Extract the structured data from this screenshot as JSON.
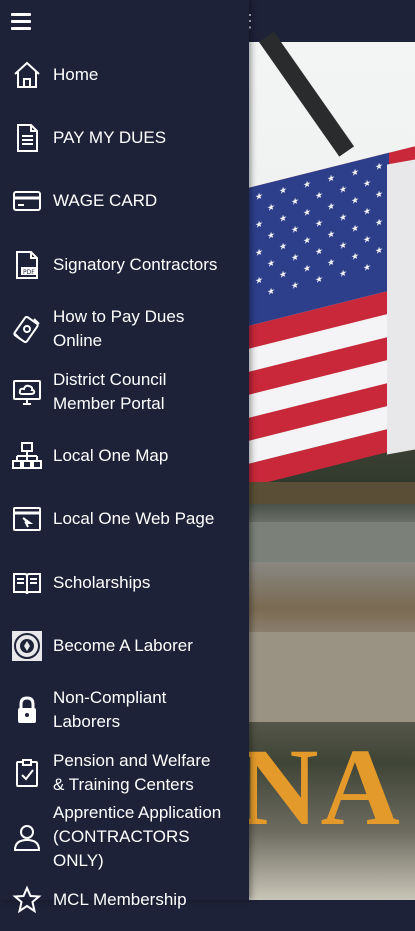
{
  "menu": {
    "items": [
      {
        "label": "Home",
        "icon": "home-icon"
      },
      {
        "label": "PAY MY DUES",
        "icon": "document-icon"
      },
      {
        "label": "WAGE CARD",
        "icon": "card-icon"
      },
      {
        "label": "Signatory Contractors",
        "icon": "pdf-icon"
      },
      {
        "label": "How to Pay Dues\nOnline",
        "icon": "money-icon"
      },
      {
        "label": "District Council\nMember Portal",
        "icon": "cloud-monitor-icon"
      },
      {
        "label": "Local One Map",
        "icon": "sitemap-icon"
      },
      {
        "label": "Local One Web Page",
        "icon": "browser-icon"
      },
      {
        "label": "Scholarships",
        "icon": "book-icon"
      },
      {
        "label": "Become A Laborer",
        "icon": "union-logo-icon"
      },
      {
        "label": "Non-Compliant\nLaborers",
        "icon": "lock-icon"
      },
      {
        "label": "Pension and Welfare\n& Training Centers",
        "icon": "clipboard-check-icon"
      },
      {
        "label": "Apprentice Application\n(CONTRACTORS ONLY)",
        "icon": "user-icon"
      },
      {
        "label": "MCL Membership",
        "icon": "star-icon"
      }
    ]
  },
  "background": {
    "banner_text": "NA"
  },
  "colors": {
    "drawer_bg": "#1e2238",
    "text": "#ffffff",
    "banner": "#e39a2a"
  }
}
